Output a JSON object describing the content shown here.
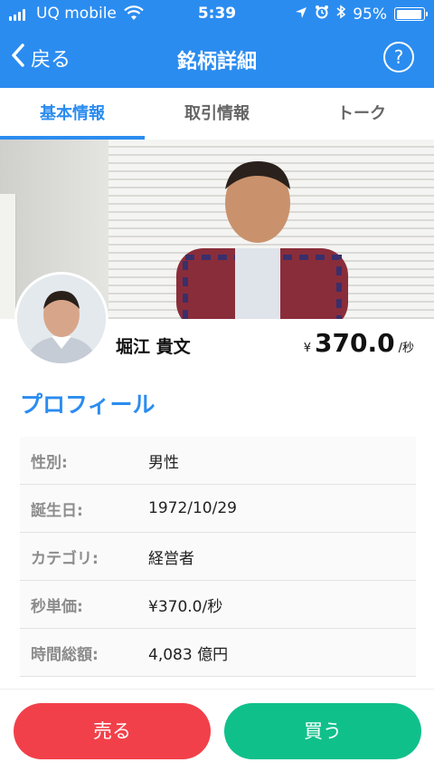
{
  "status_bar": {
    "carrier": "UQ mobile",
    "time": "5:39",
    "battery": "95%",
    "battery_level": 0.95
  },
  "nav": {
    "back_label": "戻る",
    "title": "銘柄詳細",
    "help_label": "?"
  },
  "tabs": [
    {
      "label": "基本情報",
      "active": true
    },
    {
      "label": "取引情報",
      "active": false
    },
    {
      "label": "トーク",
      "active": false
    }
  ],
  "profile": {
    "name": "堀江 貴文",
    "price_currency": "¥",
    "price_value": "370.0",
    "price_unit": "/秒"
  },
  "section_title": "プロフィール",
  "profile_table": [
    {
      "label": "性別:",
      "value": "男性"
    },
    {
      "label": "誕生日:",
      "value": "1972/10/29"
    },
    {
      "label": "カテゴリ:",
      "value": "経営者"
    },
    {
      "label": "秒単価:",
      "value": "¥370.0/秒"
    },
    {
      "label": "時間総額:",
      "value": "4,083 億円"
    }
  ],
  "actions": {
    "sell_label": "売る",
    "buy_label": "買う"
  },
  "colors": {
    "primary": "#2b8cf0",
    "sell": "#f2404a",
    "buy": "#10c08a"
  }
}
